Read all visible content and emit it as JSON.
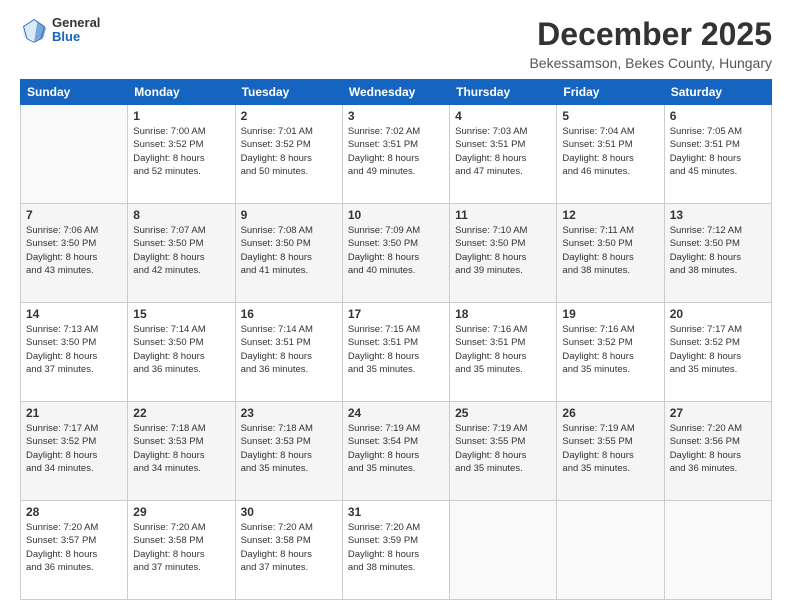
{
  "logo": {
    "general": "General",
    "blue": "Blue"
  },
  "header": {
    "month": "December 2025",
    "location": "Bekessamson, Bekes County, Hungary"
  },
  "days_of_week": [
    "Sunday",
    "Monday",
    "Tuesday",
    "Wednesday",
    "Thursday",
    "Friday",
    "Saturday"
  ],
  "weeks": [
    [
      {
        "day": "",
        "info": ""
      },
      {
        "day": "1",
        "info": "Sunrise: 7:00 AM\nSunset: 3:52 PM\nDaylight: 8 hours\nand 52 minutes."
      },
      {
        "day": "2",
        "info": "Sunrise: 7:01 AM\nSunset: 3:52 PM\nDaylight: 8 hours\nand 50 minutes."
      },
      {
        "day": "3",
        "info": "Sunrise: 7:02 AM\nSunset: 3:51 PM\nDaylight: 8 hours\nand 49 minutes."
      },
      {
        "day": "4",
        "info": "Sunrise: 7:03 AM\nSunset: 3:51 PM\nDaylight: 8 hours\nand 47 minutes."
      },
      {
        "day": "5",
        "info": "Sunrise: 7:04 AM\nSunset: 3:51 PM\nDaylight: 8 hours\nand 46 minutes."
      },
      {
        "day": "6",
        "info": "Sunrise: 7:05 AM\nSunset: 3:51 PM\nDaylight: 8 hours\nand 45 minutes."
      }
    ],
    [
      {
        "day": "7",
        "info": "Sunrise: 7:06 AM\nSunset: 3:50 PM\nDaylight: 8 hours\nand 43 minutes."
      },
      {
        "day": "8",
        "info": "Sunrise: 7:07 AM\nSunset: 3:50 PM\nDaylight: 8 hours\nand 42 minutes."
      },
      {
        "day": "9",
        "info": "Sunrise: 7:08 AM\nSunset: 3:50 PM\nDaylight: 8 hours\nand 41 minutes."
      },
      {
        "day": "10",
        "info": "Sunrise: 7:09 AM\nSunset: 3:50 PM\nDaylight: 8 hours\nand 40 minutes."
      },
      {
        "day": "11",
        "info": "Sunrise: 7:10 AM\nSunset: 3:50 PM\nDaylight: 8 hours\nand 39 minutes."
      },
      {
        "day": "12",
        "info": "Sunrise: 7:11 AM\nSunset: 3:50 PM\nDaylight: 8 hours\nand 38 minutes."
      },
      {
        "day": "13",
        "info": "Sunrise: 7:12 AM\nSunset: 3:50 PM\nDaylight: 8 hours\nand 38 minutes."
      }
    ],
    [
      {
        "day": "14",
        "info": "Sunrise: 7:13 AM\nSunset: 3:50 PM\nDaylight: 8 hours\nand 37 minutes."
      },
      {
        "day": "15",
        "info": "Sunrise: 7:14 AM\nSunset: 3:50 PM\nDaylight: 8 hours\nand 36 minutes."
      },
      {
        "day": "16",
        "info": "Sunrise: 7:14 AM\nSunset: 3:51 PM\nDaylight: 8 hours\nand 36 minutes."
      },
      {
        "day": "17",
        "info": "Sunrise: 7:15 AM\nSunset: 3:51 PM\nDaylight: 8 hours\nand 35 minutes."
      },
      {
        "day": "18",
        "info": "Sunrise: 7:16 AM\nSunset: 3:51 PM\nDaylight: 8 hours\nand 35 minutes."
      },
      {
        "day": "19",
        "info": "Sunrise: 7:16 AM\nSunset: 3:52 PM\nDaylight: 8 hours\nand 35 minutes."
      },
      {
        "day": "20",
        "info": "Sunrise: 7:17 AM\nSunset: 3:52 PM\nDaylight: 8 hours\nand 35 minutes."
      }
    ],
    [
      {
        "day": "21",
        "info": "Sunrise: 7:17 AM\nSunset: 3:52 PM\nDaylight: 8 hours\nand 34 minutes."
      },
      {
        "day": "22",
        "info": "Sunrise: 7:18 AM\nSunset: 3:53 PM\nDaylight: 8 hours\nand 34 minutes."
      },
      {
        "day": "23",
        "info": "Sunrise: 7:18 AM\nSunset: 3:53 PM\nDaylight: 8 hours\nand 35 minutes."
      },
      {
        "day": "24",
        "info": "Sunrise: 7:19 AM\nSunset: 3:54 PM\nDaylight: 8 hours\nand 35 minutes."
      },
      {
        "day": "25",
        "info": "Sunrise: 7:19 AM\nSunset: 3:55 PM\nDaylight: 8 hours\nand 35 minutes."
      },
      {
        "day": "26",
        "info": "Sunrise: 7:19 AM\nSunset: 3:55 PM\nDaylight: 8 hours\nand 35 minutes."
      },
      {
        "day": "27",
        "info": "Sunrise: 7:20 AM\nSunset: 3:56 PM\nDaylight: 8 hours\nand 36 minutes."
      }
    ],
    [
      {
        "day": "28",
        "info": "Sunrise: 7:20 AM\nSunset: 3:57 PM\nDaylight: 8 hours\nand 36 minutes."
      },
      {
        "day": "29",
        "info": "Sunrise: 7:20 AM\nSunset: 3:58 PM\nDaylight: 8 hours\nand 37 minutes."
      },
      {
        "day": "30",
        "info": "Sunrise: 7:20 AM\nSunset: 3:58 PM\nDaylight: 8 hours\nand 37 minutes."
      },
      {
        "day": "31",
        "info": "Sunrise: 7:20 AM\nSunset: 3:59 PM\nDaylight: 8 hours\nand 38 minutes."
      },
      {
        "day": "",
        "info": ""
      },
      {
        "day": "",
        "info": ""
      },
      {
        "day": "",
        "info": ""
      }
    ]
  ]
}
